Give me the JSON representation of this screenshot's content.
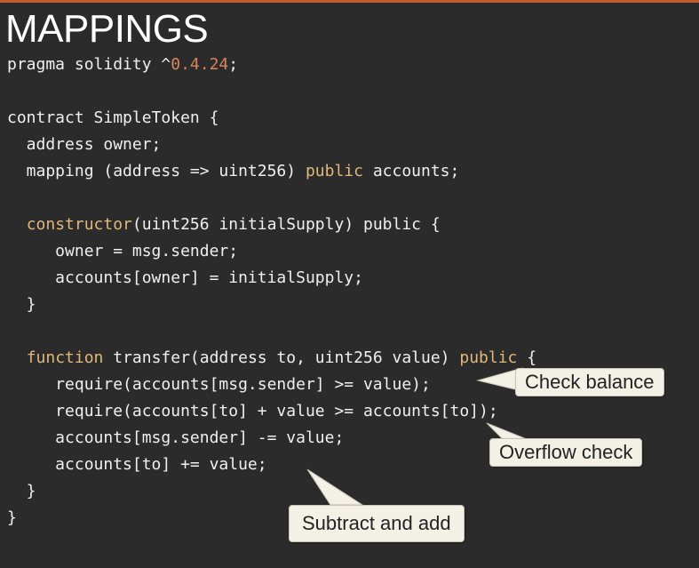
{
  "slide": {
    "title": "MAPPINGS"
  },
  "code_lines": [
    [
      {
        "t": "pragma solidity ^"
      },
      {
        "t": "0.4.24",
        "c": "num"
      },
      {
        "t": ";"
      }
    ],
    [],
    [
      {
        "t": "contract SimpleToken {"
      }
    ],
    [
      {
        "t": "  address owner;"
      }
    ],
    [
      {
        "t": "  mapping (address => uint256) "
      },
      {
        "t": "public",
        "c": "kw"
      },
      {
        "t": " accounts;"
      }
    ],
    [],
    [
      {
        "t": "  "
      },
      {
        "t": "constructor",
        "c": "kw"
      },
      {
        "t": "(uint256 initialSupply) public {"
      }
    ],
    [
      {
        "t": "     owner = msg.sender;"
      }
    ],
    [
      {
        "t": "     accounts[owner] = initialSupply;"
      }
    ],
    [
      {
        "t": "  }"
      }
    ],
    [],
    [
      {
        "t": "  "
      },
      {
        "t": "function",
        "c": "kw"
      },
      {
        "t": " transfer(address to, uint256 value) "
      },
      {
        "t": "public",
        "c": "kw"
      },
      {
        "t": " {"
      }
    ],
    [
      {
        "t": "     require(accounts[msg.sender] >= value);"
      }
    ],
    [
      {
        "t": "     require(accounts[to] + value >= accounts[to]);"
      }
    ],
    [
      {
        "t": "     accounts[msg.sender] -= value;"
      }
    ],
    [
      {
        "t": "     accounts[to] += value;"
      }
    ],
    [
      {
        "t": "  }"
      }
    ],
    [
      {
        "t": "}"
      }
    ]
  ],
  "callouts": {
    "check_balance": "Check balance",
    "overflow_check": "Overflow check",
    "subtract_and_add": "Subtract and add"
  },
  "colors": {
    "background": "#2b2b2b",
    "accent_rule": "#c65a2a",
    "code_text": "#f0f0f0",
    "keyword": "#e0b879",
    "number": "#d8875a",
    "callout_fill": "#f3f0e6"
  }
}
